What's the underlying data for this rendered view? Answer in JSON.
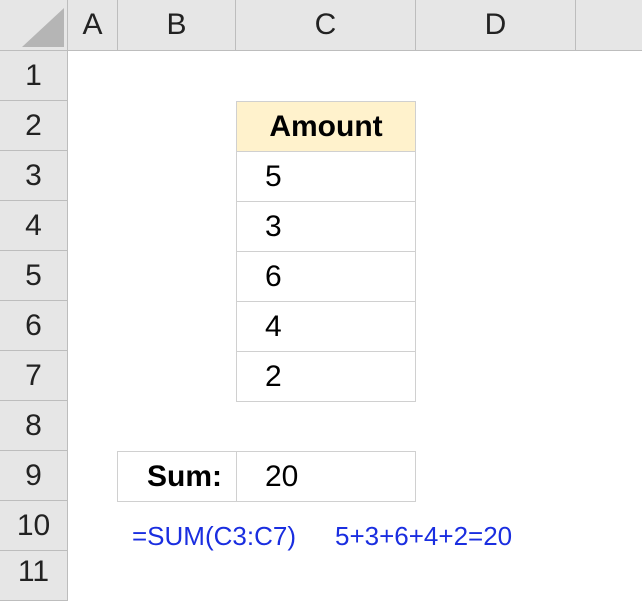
{
  "sheet": {
    "columns": [
      "A",
      "B",
      "C",
      "D"
    ],
    "rows": [
      "1",
      "2",
      "3",
      "4",
      "5",
      "6",
      "7",
      "8",
      "9",
      "10",
      "11"
    ]
  },
  "table": {
    "header": "Amount",
    "values": [
      "5",
      "3",
      "6",
      "4",
      "2"
    ],
    "header_fill": "#fff2cc"
  },
  "sum": {
    "label": "Sum:",
    "value": "20"
  },
  "notes": {
    "formula": "=SUM(C3:C7)",
    "expansion": "5+3+6+4+2=20",
    "color": "#1a2ee0"
  }
}
